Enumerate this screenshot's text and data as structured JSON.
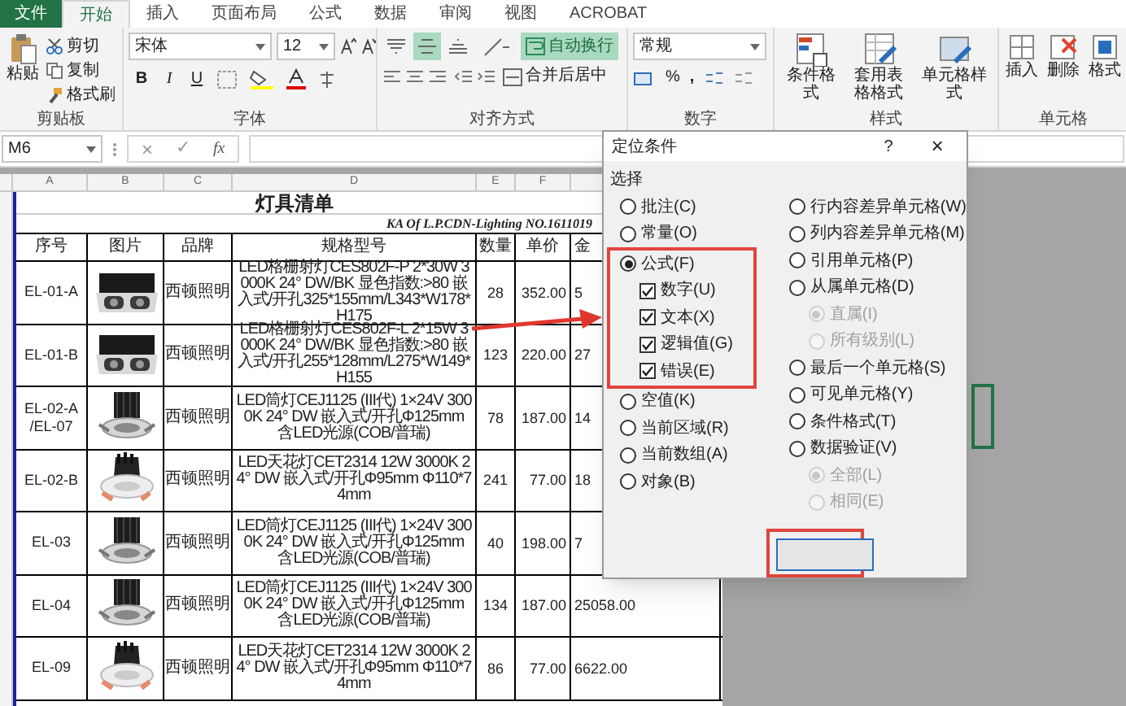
{
  "ribbon": {
    "tabs": [
      {
        "label": "文件",
        "kind": "file",
        "selected": false
      },
      {
        "label": "开始",
        "kind": "tab",
        "selected": true
      },
      {
        "label": "插入",
        "kind": "tab",
        "selected": false
      },
      {
        "label": "页面布局",
        "kind": "tab",
        "selected": false
      },
      {
        "label": "公式",
        "kind": "tab",
        "selected": false
      },
      {
        "label": "数据",
        "kind": "tab",
        "selected": false
      },
      {
        "label": "审阅",
        "kind": "tab",
        "selected": false
      },
      {
        "label": "视图",
        "kind": "tab",
        "selected": false
      },
      {
        "label": "ACROBAT",
        "kind": "tab",
        "selected": false
      }
    ],
    "clipboard": {
      "paste": "粘贴",
      "cut": "剪切",
      "copy": "复制",
      "format_painter": "格式刷",
      "label": "剪贴板"
    },
    "font": {
      "name": "宋体",
      "size": "12",
      "bold": "B",
      "italic": "I",
      "underline": "U",
      "label": "字体"
    },
    "alignment": {
      "vertical": [
        {
          "selected": false
        },
        {
          "selected": true
        },
        {
          "selected": false
        }
      ],
      "wrap_text": {
        "label": "自动换行",
        "on": true
      },
      "merge": "合并后居中",
      "label": "对齐方式"
    },
    "number": {
      "format": "常规",
      "percent": "%",
      "comma": ",",
      "label": "数字"
    },
    "styles": {
      "buttons": [
        "条件格式",
        "套用表格格式",
        "单元格样式"
      ],
      "label": "样式"
    },
    "cells": {
      "buttons": [
        "插入",
        "删除",
        "格式"
      ],
      "label": "单元格"
    }
  },
  "formula_bar": {
    "name_box": "M6",
    "cancel": "×",
    "enter": "✓",
    "fx": "fx"
  },
  "sheet": {
    "columns": [
      "A",
      "B",
      "C",
      "D",
      "E",
      "F"
    ],
    "title": "灯具清单",
    "subtitle": "KA Of L.P.CDN-Lighting NO.1611019",
    "headers": [
      "序号",
      "图片",
      "品牌",
      "规格型号",
      "数量",
      "单价",
      "金"
    ],
    "rows": [
      {
        "id": "EL-01-A",
        "brand": "西顿照明",
        "spec": "LED格栅射灯CES802F-P 2*30W 3000K 24° DW/BK 显色指数:>80 嵌入式/开孔325*155mm/L343*W178*H175",
        "qty": "28",
        "price": "352.00",
        "amount": "5"
      },
      {
        "id": "EL-01-B",
        "brand": "西顿照明",
        "spec": "LED格栅射灯CES802F-L 2*15W 3000K 24° DW/BK 显色指数:>80 嵌入式/开孔255*128mm/L275*W149*H155",
        "qty": "123",
        "price": "220.00",
        "amount": "27"
      },
      {
        "id": "EL-02-A /EL-07",
        "brand": "西顿照明",
        "spec": "LED筒灯CEJ1125 (III代) 1×24V 3000K 24° DW 嵌入式/开孔Φ125mm 含LED光源(COB/普瑞)",
        "qty": "78",
        "price": "187.00",
        "amount": "14"
      },
      {
        "id": "EL-02-B",
        "brand": "西顿照明",
        "spec": "LED天花灯CET2314 12W 3000K 24° DW 嵌入式/开孔Φ95mm Φ110*74mm",
        "qty": "241",
        "price": "77.00",
        "amount": "18"
      },
      {
        "id": "EL-03",
        "brand": "西顿照明",
        "spec": "LED筒灯CEJ1125 (III代) 1×24V 3000K 24° DW 嵌入式/开孔Φ125mm 含LED光源(COB/普瑞)",
        "qty": "40",
        "price": "198.00",
        "amount": "7"
      },
      {
        "id": "EL-04",
        "brand": "西顿照明",
        "spec": "LED筒灯CEJ1125 (III代) 1×24V 3000K 24° DW 嵌入式/开孔Φ125mm 含LED光源(COB/普瑞)",
        "qty": "134",
        "price": "187.00",
        "amount": "25058.00"
      },
      {
        "id": "EL-09",
        "brand": "西顿照明",
        "spec": "LED天花灯CET2314 12W 3000K 24° DW 嵌入式/开孔Φ95mm Φ110*74mm",
        "qty": "86",
        "price": "77.00",
        "amount": "6622.00"
      }
    ]
  },
  "dialog": {
    "title": "定位条件",
    "help": "?",
    "close": "×",
    "section": "选择",
    "left": [
      {
        "kind": "radio",
        "label": "批注(C)",
        "selected": false
      },
      {
        "kind": "radio",
        "label": "常量(O)",
        "selected": false
      },
      {
        "kind": "radio",
        "label": "公式(F)",
        "selected": true,
        "highlighted": true,
        "children": [
          {
            "kind": "checkbox",
            "label": "数字(U)",
            "checked": true
          },
          {
            "kind": "checkbox",
            "label": "文本(X)",
            "checked": true
          },
          {
            "kind": "checkbox",
            "label": "逻辑值(G)",
            "checked": true
          },
          {
            "kind": "checkbox",
            "label": "错误(E)",
            "checked": true
          }
        ]
      },
      {
        "kind": "radio",
        "label": "空值(K)",
        "selected": false
      },
      {
        "kind": "radio",
        "label": "当前区域(R)",
        "selected": false
      },
      {
        "kind": "radio",
        "label": "当前数组(A)",
        "selected": false
      },
      {
        "kind": "radio",
        "label": "对象(B)",
        "selected": false
      }
    ],
    "right": [
      {
        "kind": "radio",
        "label": "行内容差异单元格(W)",
        "selected": false
      },
      {
        "kind": "radio",
        "label": "列内容差异单元格(M)",
        "selected": false
      },
      {
        "kind": "radio",
        "label": "引用单元格(P)",
        "selected": false
      },
      {
        "kind": "radio",
        "label": "从属单元格(D)",
        "selected": false,
        "children": [
          {
            "kind": "radio",
            "label": "直属(I)",
            "selected": true,
            "disabled": true
          },
          {
            "kind": "radio",
            "label": "所有级别(L)",
            "selected": false,
            "disabled": true
          }
        ]
      },
      {
        "kind": "radio",
        "label": "最后一个单元格(S)",
        "selected": false
      },
      {
        "kind": "radio",
        "label": "可见单元格(Y)",
        "selected": false
      },
      {
        "kind": "radio",
        "label": "条件格式(T)",
        "selected": false
      },
      {
        "kind": "radio",
        "label": "数据验证(V)",
        "selected": false,
        "children": [
          {
            "kind": "radio",
            "label": "全部(L)",
            "selected": true,
            "disabled": true
          },
          {
            "kind": "radio",
            "label": "相同(E)",
            "selected": false,
            "disabled": true
          }
        ]
      }
    ],
    "footer_button": {
      "highlighted": true
    }
  }
}
